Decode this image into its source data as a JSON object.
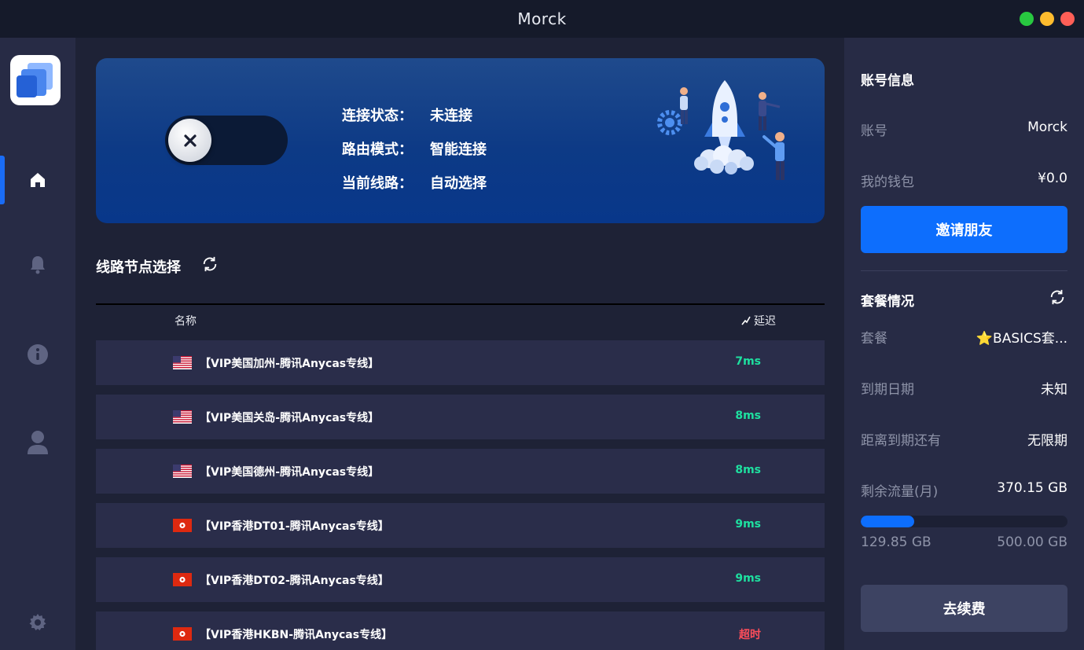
{
  "window": {
    "title": "Morck"
  },
  "status": {
    "connection_label": "连接状态：",
    "connection_value": "未连接",
    "route_mode_label": "路由模式：",
    "route_mode_value": "智能连接",
    "line_label": "当前线路：",
    "line_value": "自动选择",
    "toggle_on": false
  },
  "nodes": {
    "section_title": "线路节点选择",
    "col_name": "名称",
    "col_latency": "延迟",
    "rows": [
      {
        "flag": "us",
        "name": "【VIP美国加州-腾讯Anycas专线】",
        "latency": "7ms",
        "status": "ok"
      },
      {
        "flag": "us",
        "name": "【VIP美国关岛-腾讯Anycas专线】",
        "latency": "8ms",
        "status": "ok"
      },
      {
        "flag": "us",
        "name": "【VIP美国德州-腾讯Anycas专线】",
        "latency": "8ms",
        "status": "ok"
      },
      {
        "flag": "hk",
        "name": "【VIP香港DT01-腾讯Anycas专线】",
        "latency": "9ms",
        "status": "ok"
      },
      {
        "flag": "hk",
        "name": "【VIP香港DT02-腾讯Anycas专线】",
        "latency": "9ms",
        "status": "ok"
      },
      {
        "flag": "hk",
        "name": "【VIP香港HKBN-腾讯Anycas专线】",
        "latency": "超时",
        "status": "timeout"
      }
    ]
  },
  "account": {
    "title": "账号信息",
    "account_label": "账号",
    "account_value": "Morck",
    "wallet_label": "我的钱包",
    "wallet_value": "¥0.0",
    "invite_button": "邀请朋友"
  },
  "plan": {
    "title": "套餐情况",
    "plan_label": "套餐",
    "plan_value": "⭐BASICS套...",
    "expiry_label": "到期日期",
    "expiry_value": "未知",
    "remaining_label": "距离到期还有",
    "remaining_value": "无限期",
    "traffic_label": "剩余流量(月)",
    "traffic_value": "370.15 GB",
    "used": "129.85 GB",
    "total": "500.00 GB",
    "used_fraction": 0.2597,
    "renew_button": "去续费"
  },
  "colors": {
    "accent": "#0d6efd",
    "ok": "#1ee0a0",
    "timeout": "#ff4d5a",
    "traffic_close": "#ff5f57",
    "traffic_min": "#febc2e",
    "traffic_max": "#28c840"
  }
}
